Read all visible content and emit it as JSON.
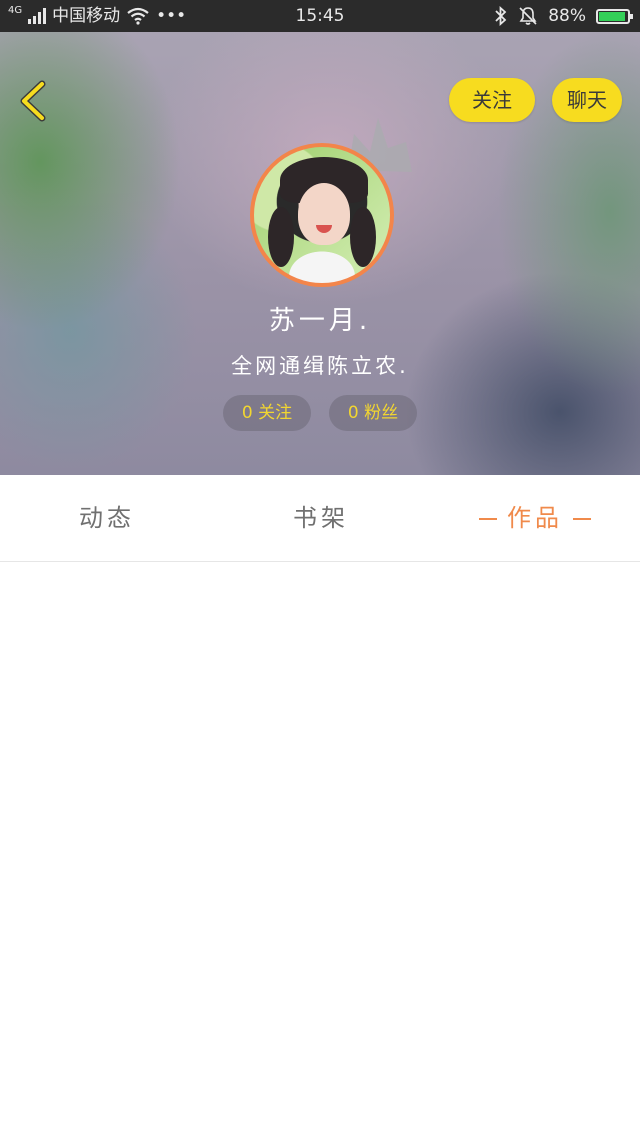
{
  "status_bar": {
    "network": "4G",
    "carrier": "中国移动",
    "dots": "•••",
    "time": "15:45",
    "battery": "88%"
  },
  "header": {
    "follow_button": "关注",
    "chat_button": "聊天",
    "username": "苏一月.",
    "signature": "全网通缉陈立农.",
    "following": "0 关注",
    "fans": "0 粉丝",
    "accent_color": "#f7dc1f",
    "avatar_border_color": "#f3854a"
  },
  "tabs": {
    "items": [
      "动态",
      "书架",
      "作品"
    ],
    "active": "作品",
    "active_color": "#f08a4b"
  }
}
